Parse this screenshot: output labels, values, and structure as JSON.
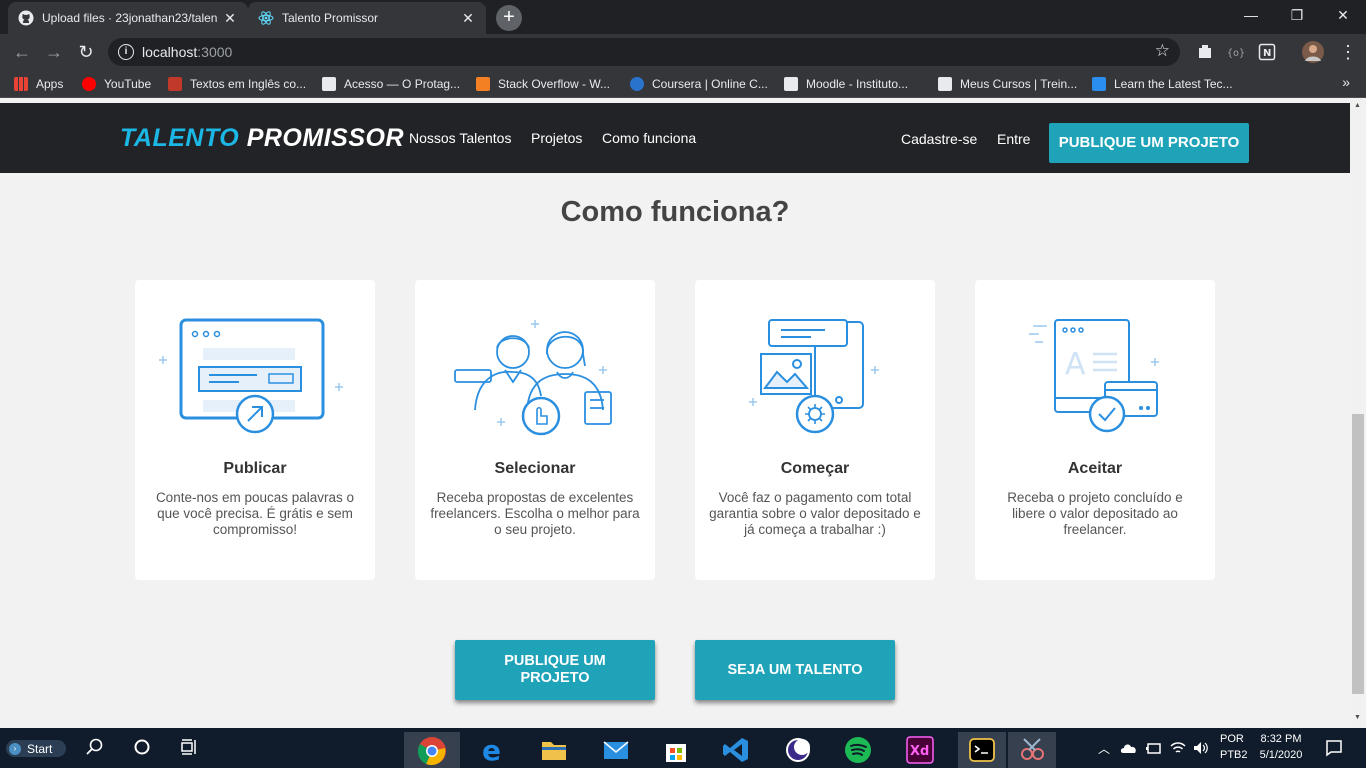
{
  "browser": {
    "tabs": [
      {
        "title": "Upload files · 23jonathan23/talen",
        "icon": "github-icon"
      },
      {
        "title": "Talento Promissor",
        "icon": "react-icon"
      }
    ],
    "url_host": "localhost",
    "url_port": ":3000",
    "bookmarks": [
      {
        "label": "Apps",
        "color": "#ea4335"
      },
      {
        "label": "YouTube",
        "color": "#ff0000"
      },
      {
        "label": "Textos em Inglês co...",
        "color": "#c0392b"
      },
      {
        "label": "Acesso — O Protag...",
        "color": "#e8eaed"
      },
      {
        "label": "Stack Overflow - W...",
        "color": "#f48024"
      },
      {
        "label": "Coursera | Online C...",
        "color": "#2a73cc"
      },
      {
        "label": "Moodle - Instituto...",
        "color": "#e8eaed"
      },
      {
        "label": "Meus Cursos | Trein...",
        "color": "#e8eaed"
      },
      {
        "label": "Learn the Latest Tec...",
        "color": "#2a8df0"
      }
    ]
  },
  "site": {
    "logo_part1": "TALENTO",
    "logo_part2": "PROMISSOR",
    "nav": [
      "Nossos Talentos",
      "Projetos",
      "Como funciona"
    ],
    "signup": "Cadastre-se",
    "login": "Entre",
    "publish_button": "PUBLIQUE UM PROJETO",
    "section_title": "Como funciona?",
    "steps": [
      {
        "title": "Publicar",
        "description": "Conte-nos em poucas palavras o que você precisa. É grátis e sem compromisso!"
      },
      {
        "title": "Selecionar",
        "description": "Receba propostas de excelentes freelancers. Escolha o melhor para o seu projeto."
      },
      {
        "title": "Começar",
        "description": "Você faz o pagamento com total garantia sobre o valor depositado e já começa a trabalhar :)"
      },
      {
        "title": "Aceitar",
        "description": "Receba o projeto concluído e libere o valor depositado ao freelancer."
      }
    ],
    "bottom_publish": "PUBLIQUE UM PROJETO",
    "bottom_talent": "SEJA UM TALENTO"
  },
  "taskbar": {
    "start_label": "Start",
    "lang_top": "POR",
    "lang_bottom": "PTB2",
    "time": "8:32 PM",
    "date": "5/1/2020"
  },
  "colors": {
    "accent": "#1fa3b8",
    "logo_blue": "#1bb8e6",
    "header_bg": "#222326",
    "illustration_blue": "#2b8fe0"
  }
}
